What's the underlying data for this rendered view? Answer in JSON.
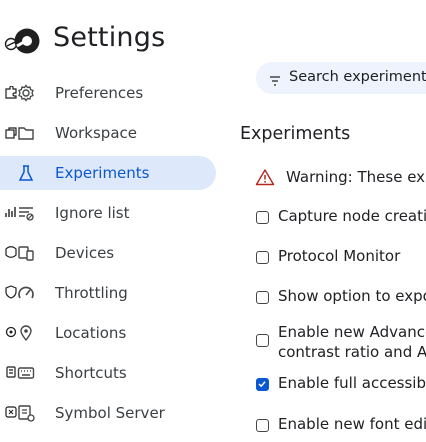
{
  "header": {
    "title": "Settings"
  },
  "search": {
    "label": "Search experiment"
  },
  "nav": {
    "items": [
      {
        "label": "Preferences",
        "icon": "gear-icon",
        "selected": false
      },
      {
        "label": "Workspace",
        "icon": "folder-icon",
        "selected": false
      },
      {
        "label": "Experiments",
        "icon": "flask-icon",
        "selected": true
      },
      {
        "label": "Ignore list",
        "icon": "filter-list-icon",
        "selected": false
      },
      {
        "label": "Devices",
        "icon": "devices-icon",
        "selected": false
      },
      {
        "label": "Throttling",
        "icon": "speedometer-icon",
        "selected": false
      },
      {
        "label": "Locations",
        "icon": "location-pin-icon",
        "selected": false
      },
      {
        "label": "Shortcuts",
        "icon": "keyboard-icon",
        "selected": false
      },
      {
        "label": "Symbol Server",
        "icon": "symbol-server-icon",
        "selected": false
      }
    ]
  },
  "experiments": {
    "title": "Experiments",
    "warning": "Warning: These exp",
    "items": [
      {
        "label": "Capture node creatic",
        "checked": false
      },
      {
        "label": "Protocol Monitor",
        "checked": false
      },
      {
        "label": "Show option to expo",
        "checked": false
      },
      {
        "label": "Enable new Advance",
        "label2": "contrast ratio and AA",
        "checked": false
      },
      {
        "label": "Enable full accessibili",
        "checked": true
      },
      {
        "label": "Enable new font edit",
        "checked": false
      }
    ]
  },
  "colors": {
    "accent": "#0b57d0",
    "selected_bg": "#dde8fb",
    "search_bg": "#eef3fd"
  }
}
